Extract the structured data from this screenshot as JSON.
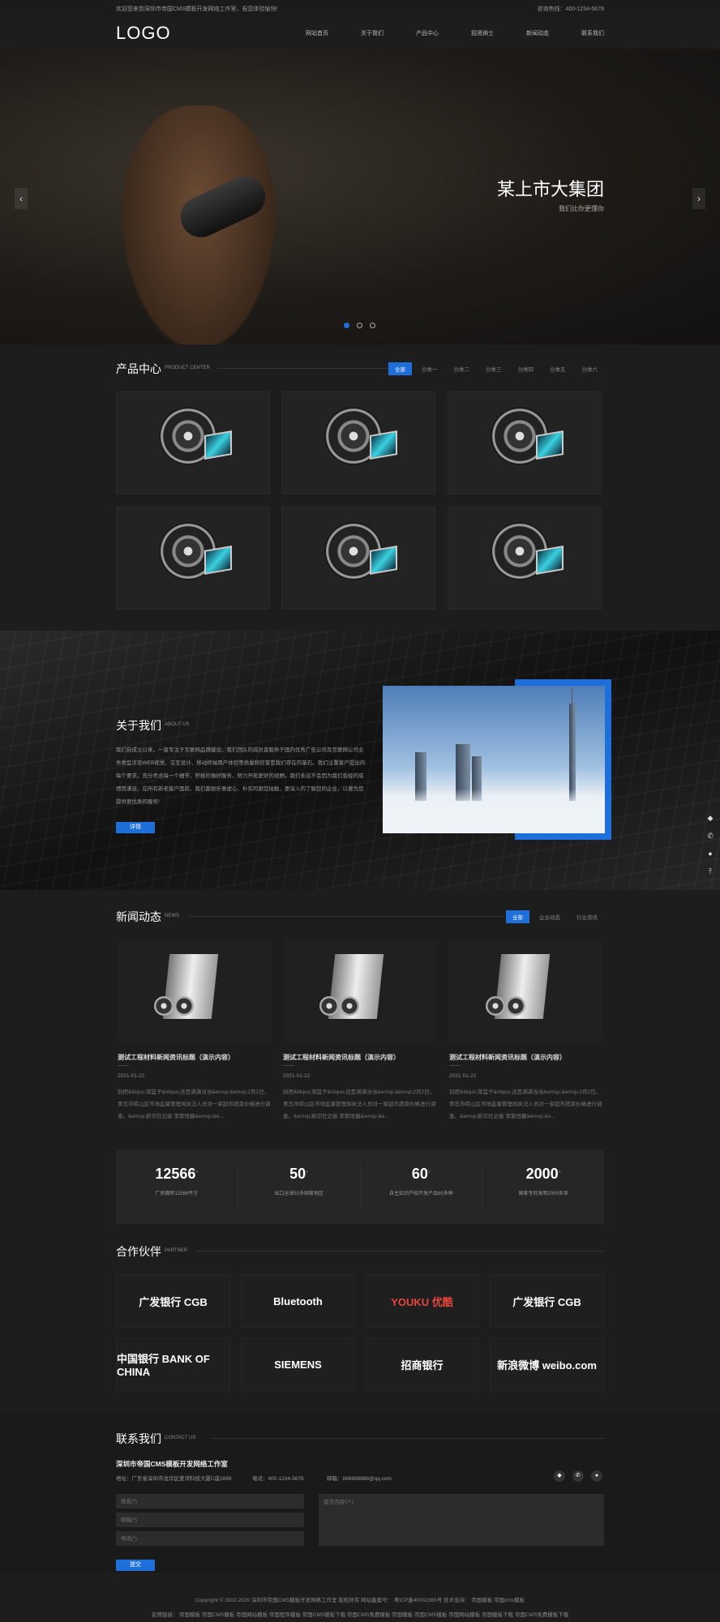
{
  "topbar": {
    "welcome": "欢迎您来到深圳市帝国CMS模板开发网络工作室，祝您体验愉快!",
    "hotline": "咨询热线：400-1234-5678"
  },
  "header": {
    "logo": "LOGO",
    "nav": [
      "网站首页",
      "关于我们",
      "产品中心",
      "招贤纳士",
      "新闻动态",
      "联系我们"
    ]
  },
  "banner": {
    "title": "某上市大集团",
    "subtitle": "我们比你更懂你",
    "prev": "‹",
    "next": "›",
    "slides": 3,
    "active_slide": 1
  },
  "products": {
    "title": "产品中心",
    "en": "PRODUCT CENTER",
    "tabs": [
      "全部",
      "分类一",
      "分类二",
      "分类三",
      "分类四",
      "分类五",
      "分类六"
    ],
    "active_tab": 0,
    "count": 6
  },
  "about": {
    "title": "关于我们",
    "en": "ABOUT US",
    "text": "我们自成立以来，一直专注于互联网品牌建设。我们团队的成员曾服务于国内优秀广告公司及互联网公司业务类型涉及WEB视觉、交互设计、移动终端用户体验等质量和信誉是我们存在的基石。我们注重客户提出的每个要求，充分考虑每一个细节，积极的做好服务，努力开拓更好的视野。我们永远不会因为我们曾经的成绩而满足。在所有新老客户面前，我们都很乐意虚心、朴实的跟您接触，更深入的了解您的企业，以便为您提供更优质的服务!",
    "button": "详情"
  },
  "news": {
    "title": "新闻动态",
    "en": "NEWS",
    "tabs": [
      "全部",
      "企业动态",
      "行业资讯"
    ],
    "active_tab": 0,
    "items": [
      {
        "title": "测试工程材料新闻资讯标题（演示内容）",
        "date": "2021-01-22",
        "desc": "别把&ldquo;菜篮子&rdquo;还是满满当当&emsp;&emsp;2月2日，青岛市崂山区市场监督管理局执法人员对一家超市蔬菜价格进行调查。&emsp;新华社记者 李紫恒摄&emsp;&e..."
      },
      {
        "title": "测试工程材料新闻资讯标题（演示内容）",
        "date": "2021-01-22",
        "desc": "别把&ldquo;菜篮子&rdquo;还是满满当当&emsp;&emsp;2月2日，青岛市崂山区市场监督管理局执法人员对一家超市蔬菜价格进行调查。&emsp;新华社记者 李紫恒摄&emsp;&e..."
      },
      {
        "title": "测试工程材料新闻资讯标题（演示内容）",
        "date": "2021-01-22",
        "desc": "别把&ldquo;菜篮子&rdquo;还是满满当当&emsp;&emsp;2月2日，青岛市崂山区市场监督管理局执法人员对一家超市蔬菜价格进行调查。&emsp;新华社记者 李紫恒摄&emsp;&e..."
      }
    ]
  },
  "stats": [
    {
      "n": "12566",
      "u": "+",
      "d": "厂房面积12566平方"
    },
    {
      "n": "50",
      "u": "+",
      "d": "出口全球50多国家地区"
    },
    {
      "n": "60",
      "u": "+",
      "d": "自主知识产权开发产品60多种"
    },
    {
      "n": "2000",
      "u": "+",
      "d": "国家专利发明2000多项"
    }
  ],
  "partners": {
    "title": "合作伙伴",
    "en": "PARTNER",
    "logos": [
      {
        "name": "广发银行 CGB",
        "color": "#ffffff"
      },
      {
        "name": "Bluetooth",
        "color": "#ffffff"
      },
      {
        "name": "YOUKU 优酷",
        "color": "#e8453c"
      },
      {
        "name": "广发银行 CGB",
        "color": "#ffffff"
      },
      {
        "name": "中国银行 BANK OF CHINA",
        "color": "#ffffff"
      },
      {
        "name": "SIEMENS",
        "color": "#ffffff"
      },
      {
        "name": "招商银行",
        "color": "#ffffff"
      },
      {
        "name": "新浪微博 weibo.com",
        "color": "#ffffff"
      }
    ]
  },
  "contact": {
    "title": "联系我们",
    "en": "CONTACT US",
    "company": "深圳市帝国CMS模板开发网络工作室",
    "address": "地址：广东省深圳市龙华区爱湾科技大厦C座1688",
    "phone": "电话：400-1234-5678",
    "email": "邮箱：888888888@qq.com",
    "name_ph": "姓名(*)",
    "email_ph": "邮箱(*)",
    "phone_ph": "电话(*)",
    "message_ph": "留言内容(*)",
    "submit": "提交"
  },
  "footer": {
    "copyright": "Copyright © 2002-2020 深圳市帝国CMS模板开发网络工作室 版权所有 网站备案号： 粤ICP备40002365号 技术支持： 帝国模板 帝国cms模板",
    "links": "友情链接： 帝国模板 帝国CMS模板 帝国网站模板 帝国程序模板 帝国CMS模板下载 帝国CMS免费模板 帝国模板 帝国CMS模板 帝国网站模板 帝国模板下载 帝国CMS免费模板下载"
  },
  "colors": {
    "accent": "#1e6fd9",
    "background": "#1d1d1d"
  },
  "side_tools": [
    "qq-icon",
    "phone-icon",
    "wechat-icon",
    "back-to-top-icon"
  ]
}
